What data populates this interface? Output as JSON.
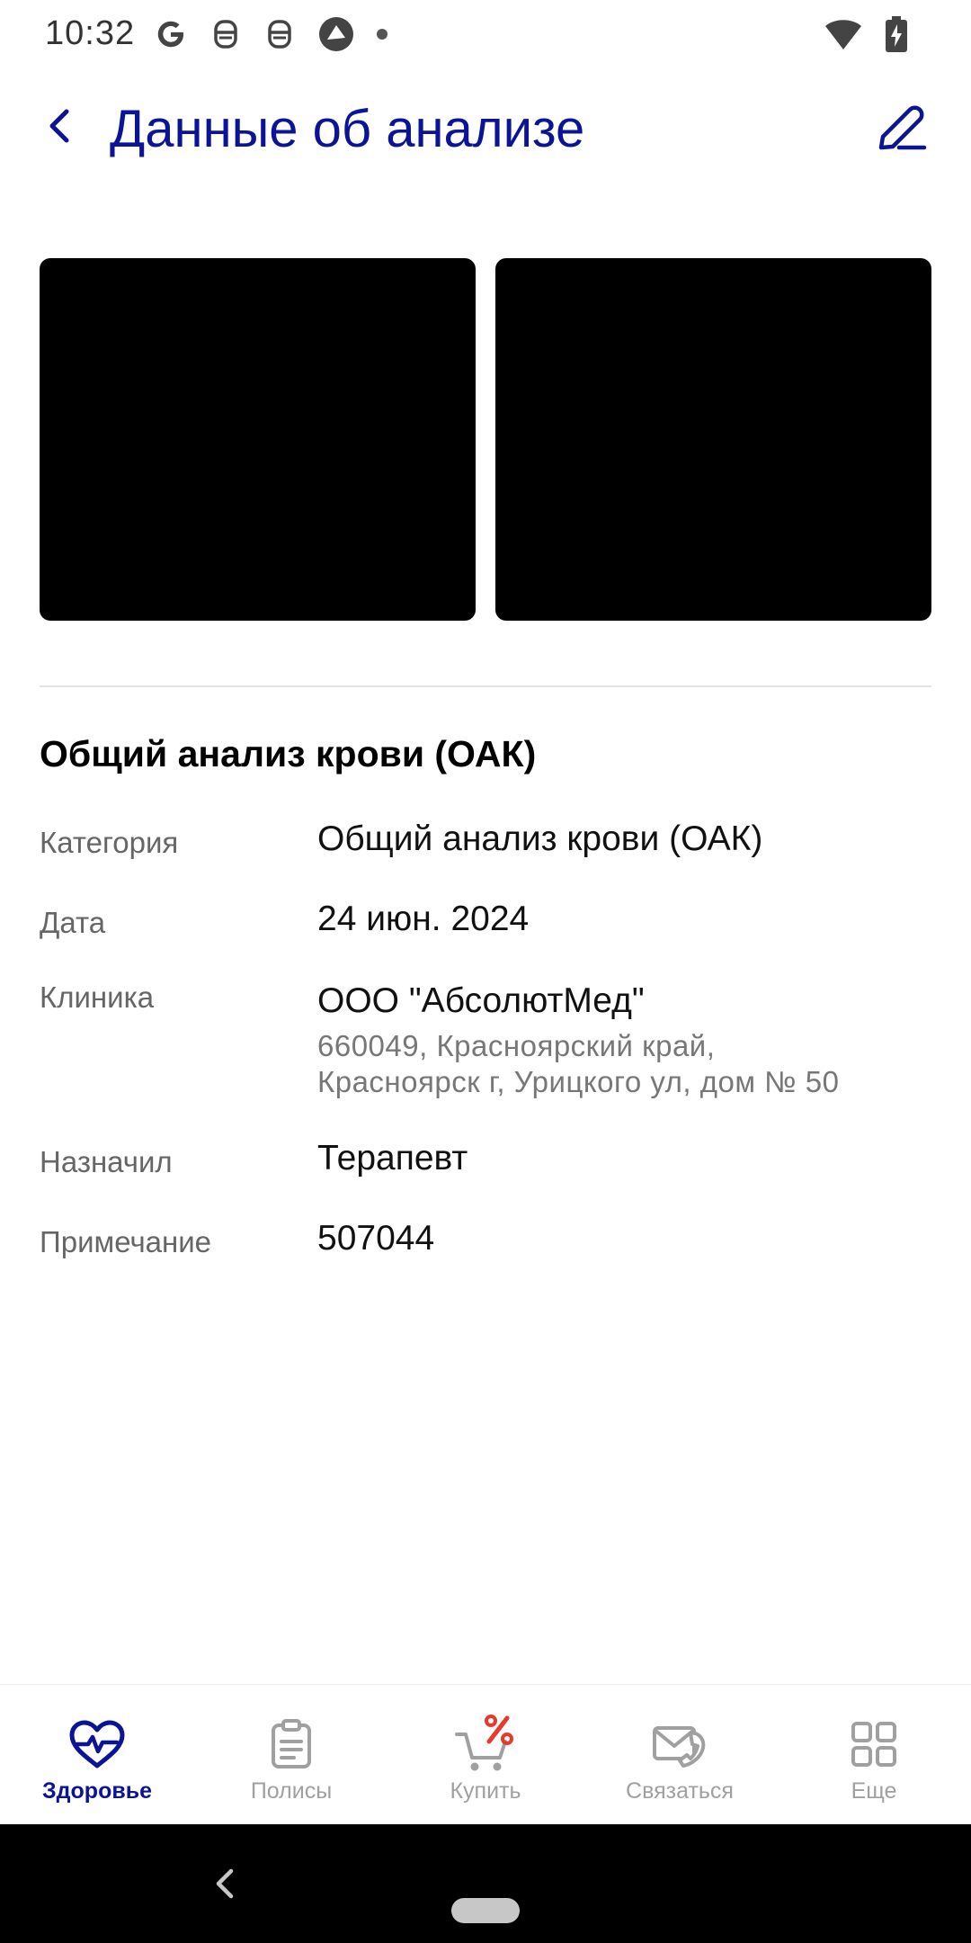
{
  "status_bar": {
    "time": "10:32",
    "icons": [
      "google-icon",
      "notification-bot-icon",
      "notification-bot-icon",
      "app-icon",
      "dot-icon"
    ],
    "right_icons": [
      "wifi-icon",
      "battery-charging-icon"
    ]
  },
  "header": {
    "title": "Данные об анализе",
    "back_icon": "chevron-left-icon",
    "edit_icon": "pencil-icon"
  },
  "analysis": {
    "title": "Общий анализ крови (ОАК)",
    "fields": [
      {
        "label": "Категория",
        "value": "Общий анализ крови (ОАК)"
      },
      {
        "label": "Дата",
        "value": "24 июн. 2024"
      },
      {
        "label": "Клиника",
        "value": "ООО \"АбсолютМед\"",
        "address_line1": "660049, Красноярский край,",
        "address_line2": "Красноярск г, Урицкого ул, дом № 50"
      },
      {
        "label": "Назначил",
        "value": "Терапевт"
      },
      {
        "label": "Примечание",
        "value": "507044"
      }
    ]
  },
  "bottom_nav": {
    "items": [
      {
        "label": "Здоровье",
        "icon": "heart-pulse-icon",
        "active": true
      },
      {
        "label": "Полисы",
        "icon": "clipboard-icon",
        "active": false
      },
      {
        "label": "Купить",
        "icon": "cart-percent-icon",
        "active": false
      },
      {
        "label": "Связаться",
        "icon": "mail-phone-icon",
        "active": false
      },
      {
        "label": "Еще",
        "icon": "grid-icon",
        "active": false
      }
    ]
  },
  "colors": {
    "accent": "#0c1496",
    "inactive": "#a0a0a0",
    "badge": "#e8392c"
  }
}
